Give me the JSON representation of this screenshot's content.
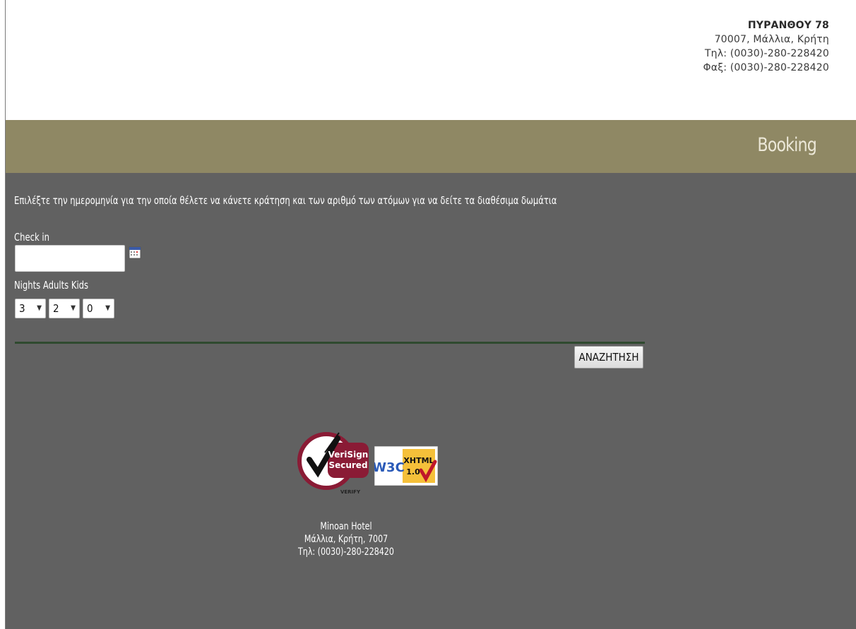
{
  "header": {
    "address_street": "ΠΥΡΑΝΘΟΥ 78",
    "address_city": "70007, Μάλλια, Κρήτη",
    "phone": "Τηλ: (0030)-280-228420",
    "fax": "Φαξ: (0030)-280-228420"
  },
  "band": {
    "title": "Booking"
  },
  "form": {
    "intro": "Επιλέξτε την ημερομηνία για την οποία θέλετε να κάνετε κράτηση και των αριθμό των ατόμων για να δείτε τα διαθέσιμα δωμάτια",
    "checkin_label": "Check in",
    "checkin_value": "",
    "guests_label": "Nights Adults Kids",
    "nights_value": "3",
    "adults_value": "2",
    "kids_value": "0",
    "search_label": "ΑΝΑΖΗΤΗΣΗ"
  },
  "badges": {
    "verisign_top": "VeriSign",
    "verisign_bottom": "Secured",
    "verisign_verify": "VERIFY",
    "w3c_text": "W3C",
    "xhtml_text": "XHTML",
    "xhtml_version": "1.0"
  },
  "footer": {
    "name": "Minoan Hotel",
    "location": "Μάλλια, Κρήτη, 7007",
    "phone": "Τηλ: (0030)-280-228420"
  },
  "colors": {
    "band": "#8f8864",
    "main_bg": "#616161",
    "divider": "#2f4a2f"
  }
}
